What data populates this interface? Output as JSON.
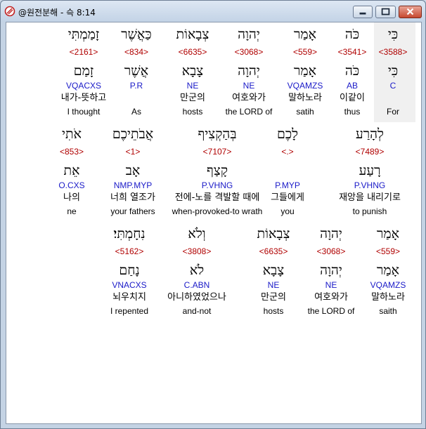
{
  "window": {
    "title": "@원전분해 - 슥 8:14"
  },
  "rows": [
    {
      "words": [
        {
          "heb": "כִּי",
          "num": "<3588>",
          "lemma": "כִּי",
          "pars": "C",
          "kor": "",
          "eng": "For"
        },
        {
          "heb": "כֹּה",
          "num": "<3541>",
          "lemma": "כֹּה",
          "pars": "AB",
          "kor": "이같이",
          "eng": "thus"
        },
        {
          "heb": "אָמַר",
          "num": "<559>",
          "lemma": "אָמַר",
          "pars": "VQAMZS",
          "kor": "말하노라",
          "eng": "satih"
        },
        {
          "heb": "יְהוָה",
          "num": "<3068>",
          "lemma": "יְהוָה",
          "pars": "NE",
          "kor": "여호와가",
          "eng": "the LORD of"
        },
        {
          "heb": "צְבָאוֹת",
          "num": "<6635>",
          "lemma": "צָבָא",
          "pars": "NE",
          "kor": "만군의",
          "eng": "hosts"
        },
        {
          "heb": "כַּאֲשֶׁר",
          "num": "<834>",
          "lemma": "אֲשֶׁר",
          "pars": "P.R",
          "kor": "",
          "eng": "As"
        },
        {
          "heb": "זָמַמְתִּי",
          "num": "<2161>",
          "lemma": "זָמַם",
          "pars": "VQACXS",
          "kor": "내가-뜻하고",
          "eng": "I thought"
        }
      ]
    },
    {
      "words": [
        {
          "heb": "לְהָרַע",
          "num": "<7489>",
          "lemma": "רָעַע",
          "pars": "P.VHNG",
          "kor": "재앙을 내리기로",
          "eng": "to punish"
        },
        {
          "heb": "לָכֶם",
          "num": "<.>",
          "lemma": "",
          "pars": "P.MYP",
          "kor": "그들에게",
          "eng": "you"
        },
        {
          "heb": "בְּהַקְצִיף",
          "num": "<7107>",
          "lemma": "קָצַף",
          "pars": "P.VHNG",
          "kor": "전에-노를 격발할 때에",
          "eng": "when-provoked-to wrath"
        },
        {
          "heb": "אֲבֹתֵיכֶם",
          "num": "<1>",
          "lemma": "אָב",
          "pars": "NMP.MYP",
          "kor": "너희 열조가",
          "eng": "your fathers"
        },
        {
          "heb": "אֹתִי",
          "num": "<853>",
          "lemma": "אֵת",
          "pars": "O.CXS",
          "kor": "나의",
          "eng": "ne"
        }
      ]
    },
    {
      "words": [
        {
          "heb": "אָמַר",
          "num": "<559>",
          "lemma": "אָמַר",
          "pars": "VQAMZS",
          "kor": "말하노라",
          "eng": "saith"
        },
        {
          "heb": "יְהוָה",
          "num": "<3068>",
          "lemma": "יְהוָה",
          "pars": "NE",
          "kor": "여호와가",
          "eng": "the LORD of"
        },
        {
          "heb": "צְבָאוֹת",
          "num": "<6635>",
          "lemma": "צָבָא",
          "pars": "NE",
          "kor": "만군의",
          "eng": "hosts"
        },
        {
          "heb": "וְלֹא",
          "num": "<3808>",
          "lemma": "לֹא",
          "pars": "C.ABN",
          "kor": "아니하였었으나",
          "eng": "and-not"
        },
        {
          "heb": "נִחָמְתִּי׃",
          "num": "<5162>",
          "lemma": "נָחַם",
          "pars": "VNACXS",
          "kor": "뇌우치지",
          "eng": "I repented"
        }
      ]
    }
  ]
}
